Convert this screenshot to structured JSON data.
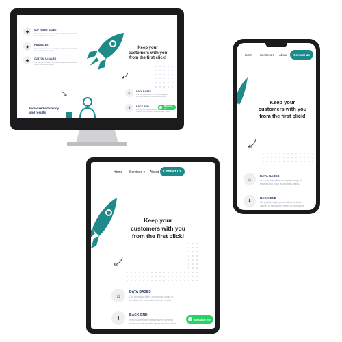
{
  "nav": {
    "home": "Home",
    "services": "Services",
    "about": "About",
    "contact": "Contact Us"
  },
  "hero": {
    "line1": "Keep your",
    "line2": "customers with you",
    "line3": "from the first click!"
  },
  "services": {
    "databases_title": "DATA BASES",
    "databases_desc1": "Our company offers a complete range of",
    "databases_desc2": "services that cover all business needs.",
    "backend_title": "BACK-END",
    "backend_desc1": "We provide highly personalized services",
    "backend_desc2": "tailored to the specific needs of each client."
  },
  "desktop_list": {
    "item1_title": "SOFTWARE SALES",
    "item2_title": "PWA SALES",
    "item3_title": "CUSTOM UI SALES",
    "item_desc": "Our company offers a complete range of services that cover all business needs."
  },
  "desktop_bottom": {
    "line1": "Increased efficiency",
    "line2": "and results"
  },
  "whatsapp": "Message me",
  "colors": {
    "teal": "#1e8a8a",
    "navy": "#1c2c5b",
    "whatsapp": "#25d366",
    "bezel": "#1b1b1d"
  },
  "icons": [
    "rocket-icon",
    "curved-arrow-icon",
    "home-icon",
    "download-icon",
    "whatsapp-icon",
    "person-icon",
    "chevron-down-icon"
  ]
}
